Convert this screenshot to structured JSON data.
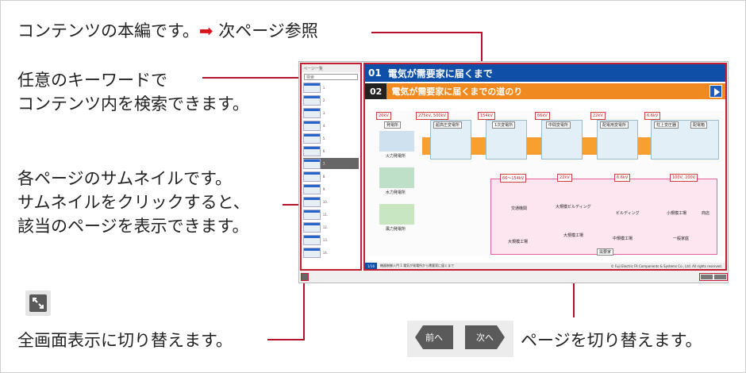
{
  "annotations": {
    "content": "コンテンツの本編です。",
    "content_ref": "次ページ参照",
    "search_line1": "任意のキーワードで",
    "search_line2": "コンテンツ内を検索できます。",
    "thumb_line1": "各ページのサムネイルです。",
    "thumb_line2": "サムネイルをクリックすると、",
    "thumb_line3": "該当のページを表示できます。",
    "fullscreen": "全画面表示に切り替えます。",
    "pager": "ページを切り替えます。"
  },
  "arrow_glyph": "➡",
  "buttons": {
    "prev": "前へ",
    "next": "次へ"
  },
  "screenshot": {
    "title_num": "01",
    "title": "電気が需要家に届くまで",
    "subtitle_num": "02",
    "subtitle": "電気が需要家に届くまでの道のり",
    "sidebar_header": "ページ一覧",
    "search_placeholder": "検索",
    "voltages": [
      "20kV",
      "275kV, 500kV",
      "154kV",
      "66kV",
      "22kV",
      "6.6kV"
    ],
    "voltages_low": [
      "66〜154kV",
      "22kV",
      "6.6kV",
      "100V, 200V"
    ],
    "nodes": [
      "発電所",
      "超高圧変電所",
      "1次変電所",
      "中間変電所",
      "配電用変電所",
      "柱上変圧器",
      "配電箱"
    ],
    "plants": [
      "火力発電所",
      "水力発電所",
      "風力発電所"
    ],
    "consumers": [
      "交通機関",
      "大規模工場",
      "大規模ビルディング",
      "大規模工場",
      "ビルディング",
      "中規模工場",
      "小規模工場",
      "商店",
      "一般家庭",
      "需要家"
    ],
    "footer_page": "1/16",
    "footer_text": "機器制御入門 1 電気が発電所から需要家に届くまで",
    "copyright": "© Fuji Electric FA Components & Systems Co., Ltd. All rights reserved."
  }
}
